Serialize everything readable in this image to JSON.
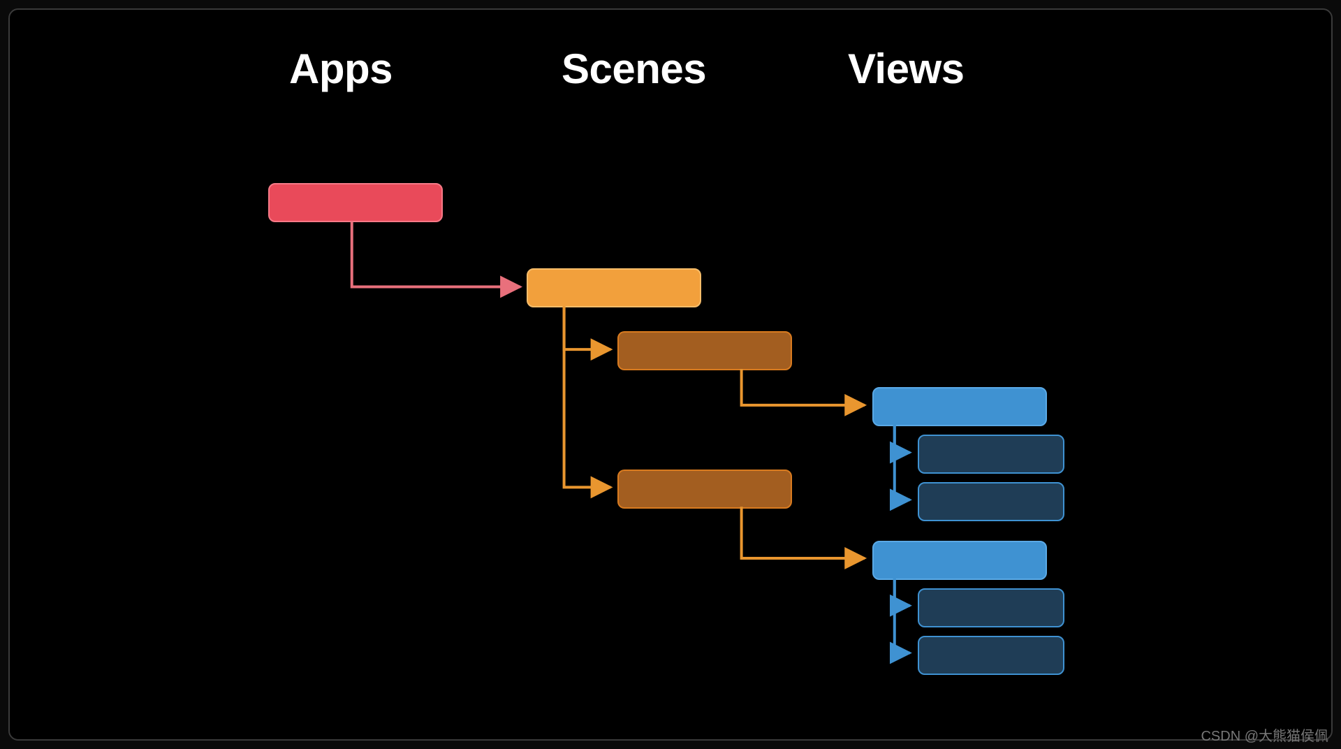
{
  "headings": {
    "apps": "Apps",
    "scenes": "Scenes",
    "views": "Views"
  },
  "watermark": "CSDN @大熊猫侯佩",
  "colors": {
    "red": "#e94a5a",
    "orange": "#f2a03c",
    "brown": "#a35e20",
    "blue": "#3f92d2",
    "navy": "#1f3d56"
  },
  "diagram": {
    "description": "Hierarchy: App → Scene → two Scene children → each leads to a View with two sub-views",
    "nodes": [
      {
        "id": "app",
        "column": "apps",
        "color": "red"
      },
      {
        "id": "scene-root",
        "column": "scenes",
        "color": "orange"
      },
      {
        "id": "scene-child-1",
        "column": "scenes",
        "color": "brown"
      },
      {
        "id": "scene-child-2",
        "column": "scenes",
        "color": "brown"
      },
      {
        "id": "view-1",
        "column": "views",
        "color": "blue"
      },
      {
        "id": "view-1-sub-1",
        "column": "views",
        "color": "navy"
      },
      {
        "id": "view-1-sub-2",
        "column": "views",
        "color": "navy"
      },
      {
        "id": "view-2",
        "column": "views",
        "color": "blue"
      },
      {
        "id": "view-2-sub-1",
        "column": "views",
        "color": "navy"
      },
      {
        "id": "view-2-sub-2",
        "column": "views",
        "color": "navy"
      }
    ],
    "edges": [
      {
        "from": "app",
        "to": "scene-root",
        "color": "red"
      },
      {
        "from": "scene-root",
        "to": "scene-child-1",
        "color": "orange"
      },
      {
        "from": "scene-root",
        "to": "scene-child-2",
        "color": "orange"
      },
      {
        "from": "scene-child-1",
        "to": "view-1",
        "color": "orange"
      },
      {
        "from": "scene-child-2",
        "to": "view-2",
        "color": "orange"
      },
      {
        "from": "view-1",
        "to": "view-1-sub-1",
        "color": "blue"
      },
      {
        "from": "view-1",
        "to": "view-1-sub-2",
        "color": "blue"
      },
      {
        "from": "view-2",
        "to": "view-2-sub-1",
        "color": "blue"
      },
      {
        "from": "view-2",
        "to": "view-2-sub-2",
        "color": "blue"
      }
    ]
  }
}
